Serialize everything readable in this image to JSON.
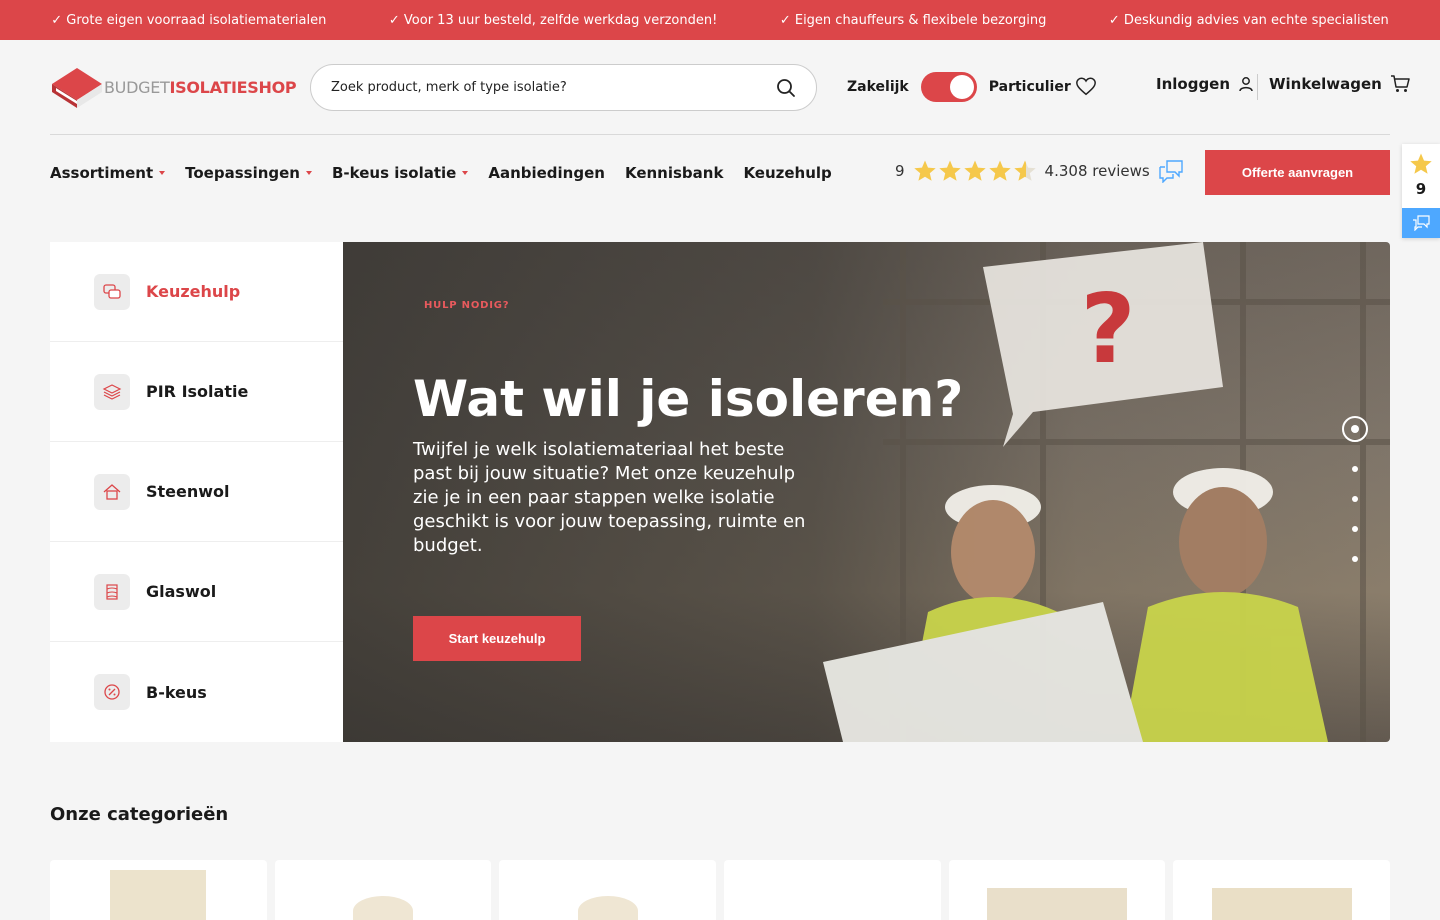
{
  "topbar": {
    "usps": [
      "✓ Grote eigen voorraad isolatiematerialen",
      "✓ Voor 13 uur besteld, zelfde werkdag verzonden!",
      "✓ Eigen chauffeurs & flexibele bezorging",
      "✓ Deskundig advies van echte specialisten"
    ]
  },
  "header": {
    "logo": {
      "part1": "BUDGET",
      "part2": "ISOLATIESHOP"
    },
    "search": {
      "placeholder": "Zoek product, merk of type isolatie?"
    },
    "toggle": {
      "left": "Zakelijk",
      "right": "Particulier",
      "state": "particulier"
    },
    "login": "Inloggen",
    "cart": "Winkelwagen"
  },
  "nav": {
    "items": [
      {
        "label": "Assortiment",
        "dropdown": true
      },
      {
        "label": "Toepassingen",
        "dropdown": true
      },
      {
        "label": "B-keus isolatie",
        "dropdown": true
      },
      {
        "label": "Aanbiedingen",
        "dropdown": false
      },
      {
        "label": "Kennisbank",
        "dropdown": false
      },
      {
        "label": "Keuzehulp",
        "dropdown": false
      }
    ],
    "rating": {
      "score": "9",
      "stars": 4.5,
      "reviews": "4.308 reviews"
    },
    "cta": "Offerte aanvragen"
  },
  "side_badge": {
    "score": "9"
  },
  "side_menu": {
    "items": [
      {
        "label": "Keuzehulp",
        "icon": "chat-bubbles-icon",
        "active": true
      },
      {
        "label": "PIR Isolatie",
        "icon": "stack-icon",
        "active": false
      },
      {
        "label": "Steenwol",
        "icon": "house-icon",
        "active": false
      },
      {
        "label": "Glaswol",
        "icon": "wool-icon",
        "active": false
      },
      {
        "label": "B-keus",
        "icon": "percent-badge-icon",
        "active": false
      }
    ]
  },
  "hero": {
    "pretitle": "HULP NODIG?",
    "title": "Wat wil je isoleren?",
    "text": "Twijfel je welk isolatiemateriaal het beste past bij jouw situatie? Met onze keuzehulp zie je in een paar stappen welke isolatie geschikt is voor jouw toepassing, ruimte en budget.",
    "cta": "Start keuzehulp",
    "slides": 5,
    "active_slide": 1
  },
  "categories": {
    "title": "Onze categorieën",
    "count": 6
  },
  "colors": {
    "brand": "#dc4649",
    "chat": "#4ea8ff",
    "star": "#f5c84b"
  }
}
